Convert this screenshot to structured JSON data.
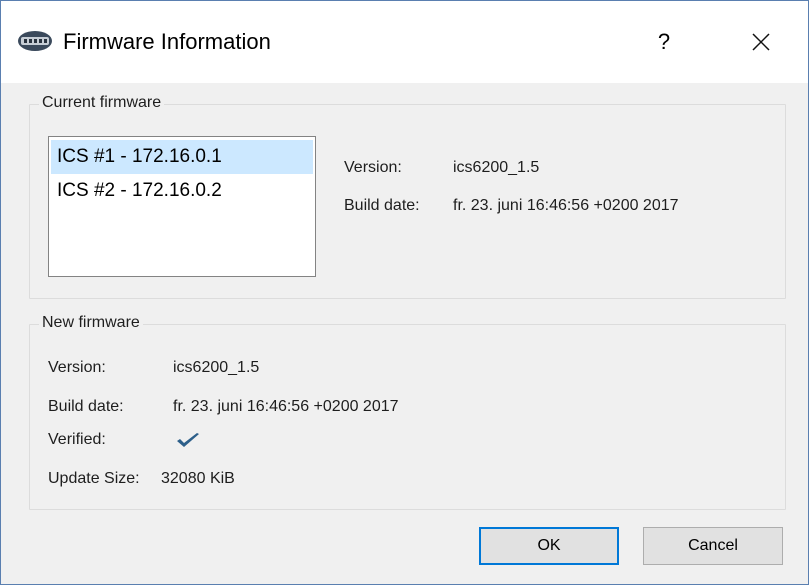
{
  "window": {
    "title": "Firmware Information",
    "help_label": "?",
    "close_icon": "close-icon",
    "app_icon": "network-device-icon"
  },
  "current_firmware": {
    "group_title": "Current firmware",
    "devices": [
      {
        "label": "ICS #1 - 172.16.0.1",
        "selected": true
      },
      {
        "label": "ICS #2 - 172.16.0.2",
        "selected": false
      }
    ],
    "version_label": "Version:",
    "version_value": "ics6200_1.5",
    "build_date_label": "Build date:",
    "build_date_value": "fr. 23. juni 16:46:56 +0200 2017"
  },
  "new_firmware": {
    "group_title": "New firmware",
    "version_label": "Version:",
    "version_value": "ics6200_1.5",
    "build_date_label": "Build date:",
    "build_date_value": "fr. 23. juni 16:46:56 +0200 2017",
    "verified_label": "Verified:",
    "verified_icon": "checkmark-icon",
    "update_size_label": "Update Size:",
    "update_size_value": "32080 KiB"
  },
  "buttons": {
    "ok_label": "OK",
    "cancel_label": "Cancel"
  },
  "colors": {
    "selection": "#cce8ff",
    "accent": "#0078d7",
    "checkmark": "#2d5f8a"
  }
}
